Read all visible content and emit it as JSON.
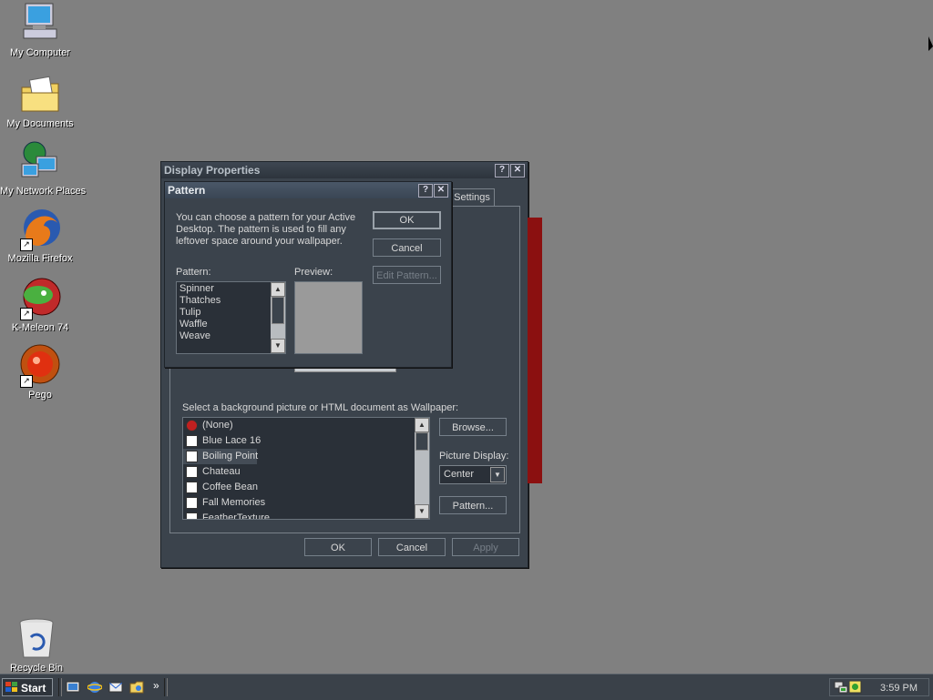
{
  "desktop": {
    "icons": [
      {
        "label": "My Computer",
        "icon": "my-computer-icon"
      },
      {
        "label": "My Documents",
        "icon": "my-documents-icon"
      },
      {
        "label": "My Network Places",
        "icon": "network-places-icon"
      },
      {
        "label": "Mozilla Firefox",
        "icon": "firefox-icon"
      },
      {
        "label": "K-Meleon 74",
        "icon": "k-meleon-icon"
      },
      {
        "label": "Pego",
        "icon": "pego-icon"
      },
      {
        "label": "Recycle Bin",
        "icon": "recycle-bin-icon"
      }
    ]
  },
  "display_properties": {
    "title": "Display Properties",
    "help_glyph": "?",
    "close_glyph": "✕",
    "visible_tab": "Settings",
    "wallpaper_label": "Select a background picture or HTML document as Wallpaper:",
    "wallpapers": [
      "(None)",
      "Blue Lace 16",
      "Boiling Point",
      "Chateau",
      "Coffee Bean",
      "Fall Memories",
      "FeatherTexture"
    ],
    "selected_wallpaper": "Boiling Point",
    "browse_label": "Browse...",
    "picture_display_label": "Picture Display:",
    "picture_display_value": "Center",
    "pattern_button_label": "Pattern...",
    "ok_label": "OK",
    "cancel_label": "Cancel",
    "apply_label": "Apply"
  },
  "pattern_dialog": {
    "title": "Pattern",
    "help_glyph": "?",
    "close_glyph": "✕",
    "description": "You can choose a pattern for your Active Desktop.  The pattern is used to fill any leftover space around your wallpaper.",
    "ok_label": "OK",
    "cancel_label": "Cancel",
    "edit_pattern_label": "Edit Pattern...",
    "pattern_label": "Pattern:",
    "preview_label": "Preview:",
    "patterns": [
      "Spinner",
      "Thatches",
      "Tulip",
      "Waffle",
      "Weave"
    ]
  },
  "taskbar": {
    "start_label": "Start",
    "clock": "3:59 PM",
    "chevron": "»"
  },
  "colors": {
    "desktop": "#808080",
    "window": "#3b434c",
    "wallpaper_preview": "#8b1010"
  }
}
